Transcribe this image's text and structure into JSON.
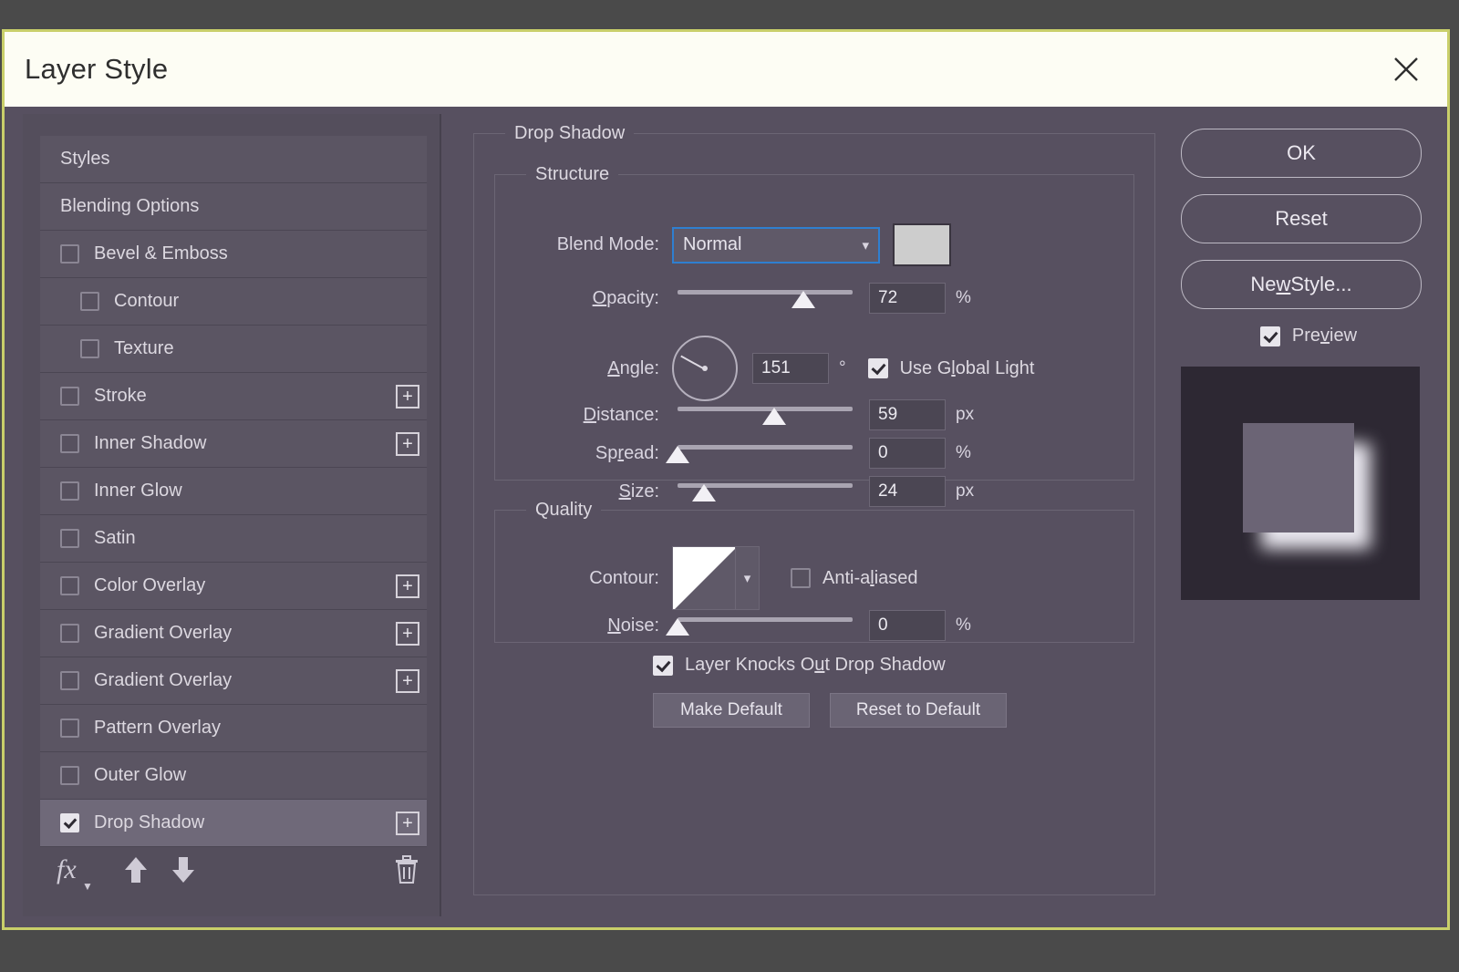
{
  "window": {
    "title": "Layer Style",
    "close_icon": "close-icon",
    "accent_border": "#c9cf6a",
    "dialog_bg": "#575060",
    "desktop_bg": "#4a4a4a"
  },
  "sidebar": {
    "items": [
      {
        "label": "Styles",
        "checkbox": false,
        "checked": false,
        "indent": false,
        "plus": false,
        "selected": false
      },
      {
        "label": "Blending Options",
        "checkbox": false,
        "checked": false,
        "indent": false,
        "plus": false,
        "selected": false
      },
      {
        "label": "Bevel & Emboss",
        "checkbox": true,
        "checked": false,
        "indent": false,
        "plus": false,
        "selected": false
      },
      {
        "label": "Contour",
        "checkbox": true,
        "checked": false,
        "indent": true,
        "plus": false,
        "selected": false
      },
      {
        "label": "Texture",
        "checkbox": true,
        "checked": false,
        "indent": true,
        "plus": false,
        "selected": false
      },
      {
        "label": "Stroke",
        "checkbox": true,
        "checked": false,
        "indent": false,
        "plus": true,
        "selected": false
      },
      {
        "label": "Inner Shadow",
        "checkbox": true,
        "checked": false,
        "indent": false,
        "plus": true,
        "selected": false
      },
      {
        "label": "Inner Glow",
        "checkbox": true,
        "checked": false,
        "indent": false,
        "plus": false,
        "selected": false
      },
      {
        "label": "Satin",
        "checkbox": true,
        "checked": false,
        "indent": false,
        "plus": false,
        "selected": false
      },
      {
        "label": "Color Overlay",
        "checkbox": true,
        "checked": false,
        "indent": false,
        "plus": true,
        "selected": false
      },
      {
        "label": "Gradient Overlay",
        "checkbox": true,
        "checked": false,
        "indent": false,
        "plus": true,
        "selected": false
      },
      {
        "label": "Gradient Overlay",
        "checkbox": true,
        "checked": false,
        "indent": false,
        "plus": true,
        "selected": false
      },
      {
        "label": "Pattern Overlay",
        "checkbox": true,
        "checked": false,
        "indent": false,
        "plus": false,
        "selected": false
      },
      {
        "label": "Outer Glow",
        "checkbox": true,
        "checked": false,
        "indent": false,
        "plus": false,
        "selected": false
      },
      {
        "label": "Drop Shadow",
        "checkbox": true,
        "checked": true,
        "indent": false,
        "plus": true,
        "selected": true
      }
    ],
    "plus_label": "+",
    "toolbar": {
      "fx_label": "fx",
      "fx_icon": "fx-icon",
      "up_icon": "arrow-up-icon",
      "down_icon": "arrow-down-icon",
      "trash_icon": "trash-icon"
    }
  },
  "main": {
    "effect_title": "Drop Shadow",
    "structure": {
      "legend": "Structure",
      "blend_mode": {
        "label": "Blend Mode:",
        "value": "Normal",
        "color_swatch": "#cdcdcd"
      },
      "opacity": {
        "label": "Opacity:",
        "value": "72",
        "unit": "%",
        "percent": 72
      },
      "angle": {
        "label": "Angle:",
        "value": "151",
        "unit": "°",
        "degrees": 151
      },
      "use_global_light": {
        "label": "Use Global Light",
        "checked": true
      },
      "distance": {
        "label": "Distance:",
        "value": "59",
        "unit": "px",
        "percent": 55
      },
      "spread": {
        "label": "Spread:",
        "value": "0",
        "unit": "%",
        "percent": 0
      },
      "size": {
        "label": "Size:",
        "value": "24",
        "unit": "px",
        "percent": 15
      }
    },
    "quality": {
      "legend": "Quality",
      "contour": {
        "label": "Contour:",
        "shape": "linear"
      },
      "anti_aliased": {
        "label": "Anti-aliased",
        "checked": false
      },
      "noise": {
        "label": "Noise:",
        "value": "0",
        "unit": "%",
        "percent": 0
      }
    },
    "knockout": {
      "label": "Layer Knocks Out Drop Shadow",
      "checked": true
    },
    "make_default": "Make Default",
    "reset_to_default": "Reset to Default"
  },
  "right": {
    "ok": "OK",
    "reset": "Reset",
    "new_style": "New Style...",
    "preview": {
      "label": "Preview",
      "checked": true
    }
  }
}
